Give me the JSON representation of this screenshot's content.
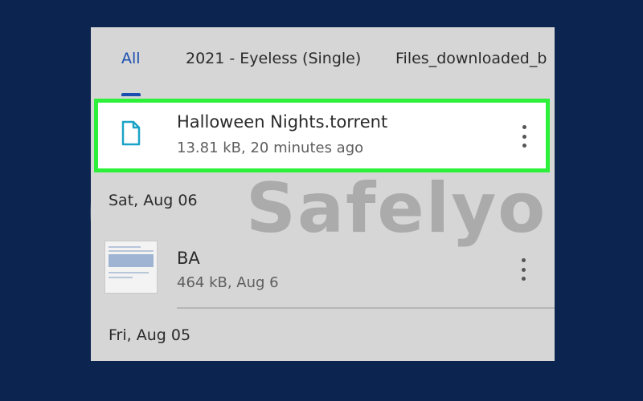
{
  "tabs": [
    {
      "label": "All",
      "active": true
    },
    {
      "label": "2021 - Eyeless (Single)"
    },
    {
      "label": "Files_downloaded_b"
    }
  ],
  "highlighted_file": {
    "name": "Halloween Nights.torrent",
    "meta": "13.81 kB, 20 minutes ago",
    "icon": "document-icon",
    "highlight_color": "#2df03a"
  },
  "sections": [
    {
      "date": "Sat, Aug 06",
      "files": [
        {
          "name": "BA",
          "meta": "464 kB, Aug 6",
          "icon": "thumbnail"
        }
      ]
    },
    {
      "date": "Fri, Aug 05",
      "files": []
    }
  ],
  "watermark": {
    "text": "Safelyo"
  },
  "colors": {
    "background": "#0b2550",
    "accent": "#1a4fb0",
    "file_icon": "#1ba3c7"
  }
}
